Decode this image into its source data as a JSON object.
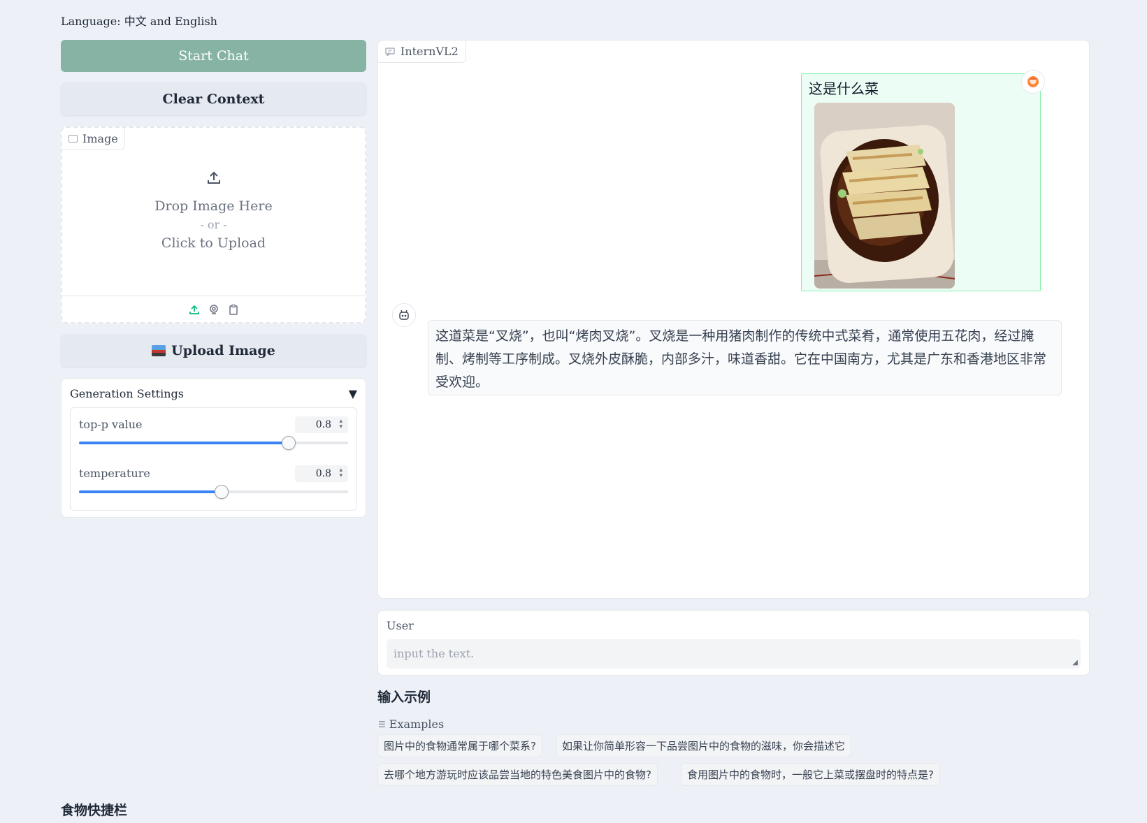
{
  "language_line": "Language: 中文 and English",
  "buttons": {
    "start_chat": "Start Chat",
    "clear_context": "Clear Context",
    "upload_image": "Upload Image"
  },
  "image_block": {
    "tab_label": "Image",
    "drop_text": "Drop Image Here",
    "or_text": "- or -",
    "click_text": "Click to Upload"
  },
  "generation_settings": {
    "title": "Generation Settings",
    "collapse_glyph": "▼",
    "top_p": {
      "label": "top-p value",
      "value": "0.8",
      "level": 0.78
    },
    "temperature": {
      "label": "temperature",
      "value": "0.8",
      "level": 0.53
    }
  },
  "chat": {
    "tab_label": "InternVL2",
    "user_message": "这是什么菜",
    "bot_message": "这道菜是“叉烧”，也叫“烤肉叉烧”。叉烧是一种用猪肉制作的传统中式菜肴，通常使用五花肉，经过腌制、烤制等工序制成。叉烧外皮酥脆，内部多汁，味道香甜。它在中国南方，尤其是广东和香港地区非常受欢迎。"
  },
  "input": {
    "label": "User",
    "placeholder": "input the text.",
    "value": ""
  },
  "examples": {
    "section_title": "输入示例",
    "label": "Examples",
    "items": [
      "图片中的食物通常属于哪个菜系?",
      "如果让你简单形容一下品尝图片中的食物的滋味，你会描述它",
      "去哪个地方游玩时应该品尝当地的特色美食图片中的食物?",
      "食用图片中的食物时，一般它上菜或摆盘时的特点是?"
    ]
  },
  "food_shortcut_title": "食物快捷栏",
  "colors": {
    "accent": "#87b3a4",
    "slider": "#3b82f6",
    "user_bubble": "#ecfdf5",
    "user_bubble_border": "#86efac",
    "page_bg": "#edf1f7"
  },
  "icons": [
    "image-icon",
    "upload-icon",
    "webcam-icon",
    "clipboard-icon",
    "chat-icon",
    "user-avatar-icon",
    "bot-avatar-icon",
    "list-icon"
  ]
}
